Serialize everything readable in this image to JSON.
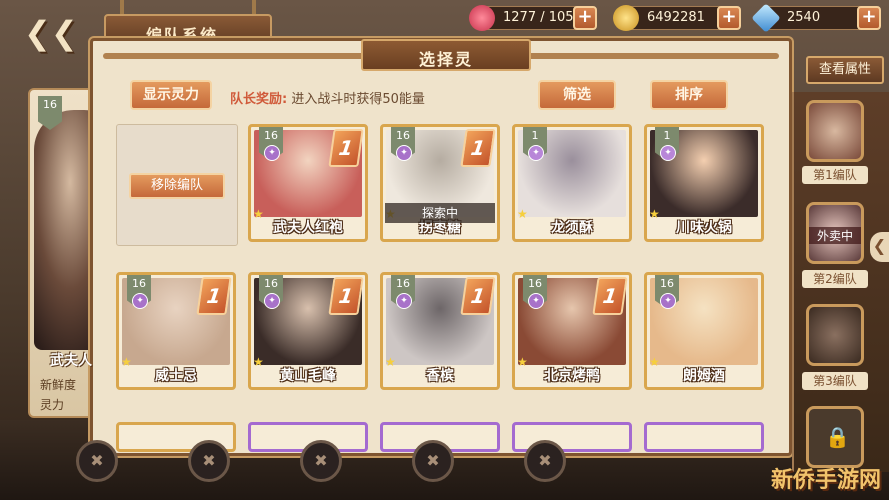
{
  "header": {
    "title": "编队系统",
    "stamina": "1277 / 105",
    "coins": "6492281",
    "gems": "2540"
  },
  "left_panel": {
    "level": "16",
    "name": "武夫人",
    "stat1": "新鲜度",
    "stat2": "灵力"
  },
  "modal": {
    "title": "选择灵",
    "show_spirit": "显示灵力",
    "captain_label": "队长奖励:",
    "captain_text": "进入战斗时获得50能量",
    "filter": "筛选",
    "sort": "排序",
    "remove": "移除编队",
    "explore_tag": "探索中"
  },
  "cards_row1": [
    {
      "name": "武夫人红袍",
      "level": "16",
      "rank": "1",
      "colors": [
        "#c85f5a",
        "#f2d4c0"
      ]
    },
    {
      "name": "拐枣糖",
      "level": "16",
      "rank": "1",
      "colors": [
        "#efe8de",
        "#b5aca1"
      ]
    },
    {
      "name": "龙须酥",
      "level": "1",
      "rank": "",
      "colors": [
        "#e6dfdc",
        "#9a8f9c"
      ]
    },
    {
      "name": "川味火锅",
      "level": "1",
      "rank": "",
      "colors": [
        "#3b2c2a",
        "#f4cfb0"
      ]
    }
  ],
  "cards_row2": [
    {
      "name": "威士忌",
      "level": "16",
      "rank": "1",
      "colors": [
        "#c7a88f",
        "#e8d3c1"
      ]
    },
    {
      "name": "黄山毛峰",
      "level": "16",
      "rank": "1",
      "colors": [
        "#3a2c28",
        "#d8c0ad"
      ]
    },
    {
      "name": "香槟",
      "level": "16",
      "rank": "1",
      "colors": [
        "#cdc6c4",
        "#6d6668"
      ]
    },
    {
      "name": "北京烤鸭",
      "level": "16",
      "rank": "1",
      "colors": [
        "#8a4a35",
        "#e6c6ad"
      ]
    },
    {
      "name": "朗姆酒",
      "level": "16",
      "rank": "",
      "colors": [
        "#e6b98b",
        "#f5e2c2"
      ]
    }
  ],
  "right_panel": {
    "view_attr": "查看属性",
    "team1": "第1编队",
    "team2": "第2编队",
    "team3": "第3编队",
    "team2_tag": "外卖中"
  },
  "watermark": "新侨手游网",
  "colors": {
    "accent": "#c5693a",
    "frame": "#d9a64d",
    "panel": "#efe3cb"
  }
}
